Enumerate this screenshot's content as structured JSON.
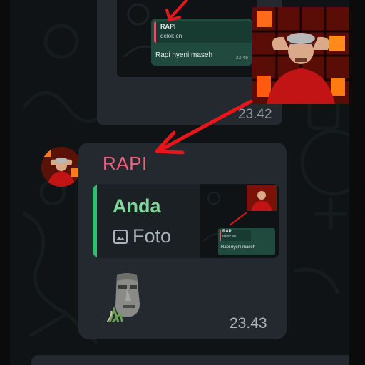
{
  "previous_message": {
    "reply_card": {
      "quoted_name": "RAPI",
      "quoted_text": "delok en",
      "text": "Rapi nyeni maseh",
      "time": "23.48"
    },
    "time": "23.42"
  },
  "message": {
    "sender": "RAPI",
    "quoted": {
      "name": "Anda",
      "type_label": "Foto",
      "icon": "image-icon",
      "thumb_reply": {
        "quoted_name": "RAPI",
        "quoted_text": "delok en",
        "text": "Rapi nyeni maseh"
      }
    },
    "sticker": "moai-sticker",
    "time": "23.43"
  },
  "colors": {
    "sender_name": "#ee6079",
    "quote_bar": "#2fbe6d",
    "quote_name": "#7fd79a",
    "annotation_arrow": "#e8151b",
    "bubble": "#23292e"
  }
}
